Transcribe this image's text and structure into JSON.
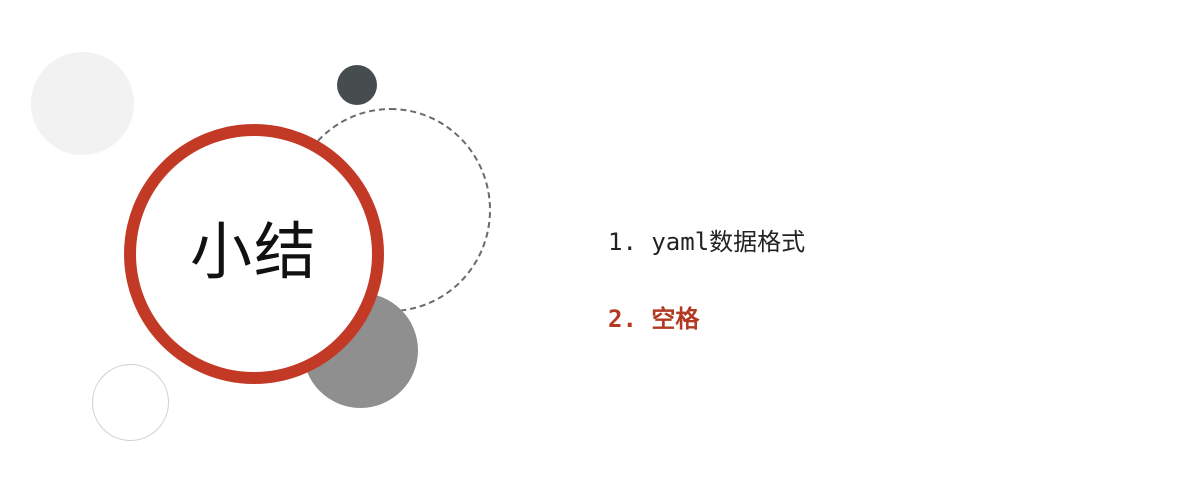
{
  "slide": {
    "title": "小结",
    "items": [
      {
        "text": "1. yaml数据格式",
        "color": "#222222"
      },
      {
        "text": "2. 空格",
        "color": "#b33a22",
        "highlighted": true
      }
    ]
  },
  "colors": {
    "accent_red": "#c23a26",
    "highlight_text": "#b33a22",
    "dark_dot": "#474c4f",
    "mid_grey": "#8f8f8f",
    "light_grey": "#f2f2f2"
  }
}
